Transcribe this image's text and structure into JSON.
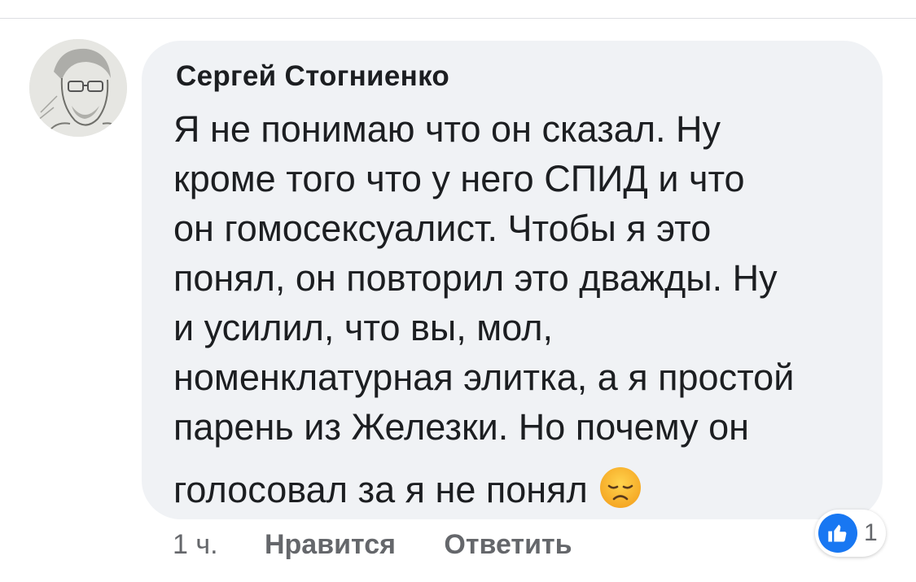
{
  "comment": {
    "author": "Сергей Стогниенко",
    "message_lines": [
      "Я не понимаю что он сказал. Ну",
      "кроме того что у него СПИД и что",
      "он гомосексуалист. Чтобы я это",
      "понял, он повторил это дважды. Ну",
      "и усилил, что вы, мол,",
      "номенклатурная элитка, а я простой",
      "парень из Железки. Но почему он",
      "голосовал за я не понял"
    ],
    "emoji": "disappointed-face-icon",
    "timestamp": "1 ч.",
    "like_label": "Нравится",
    "reply_label": "Ответить",
    "reaction_count": "1"
  },
  "colors": {
    "bubble": "#f0f2f5",
    "text": "#1c1e21",
    "muted": "#65676b",
    "like_blue": "#1877f2"
  }
}
